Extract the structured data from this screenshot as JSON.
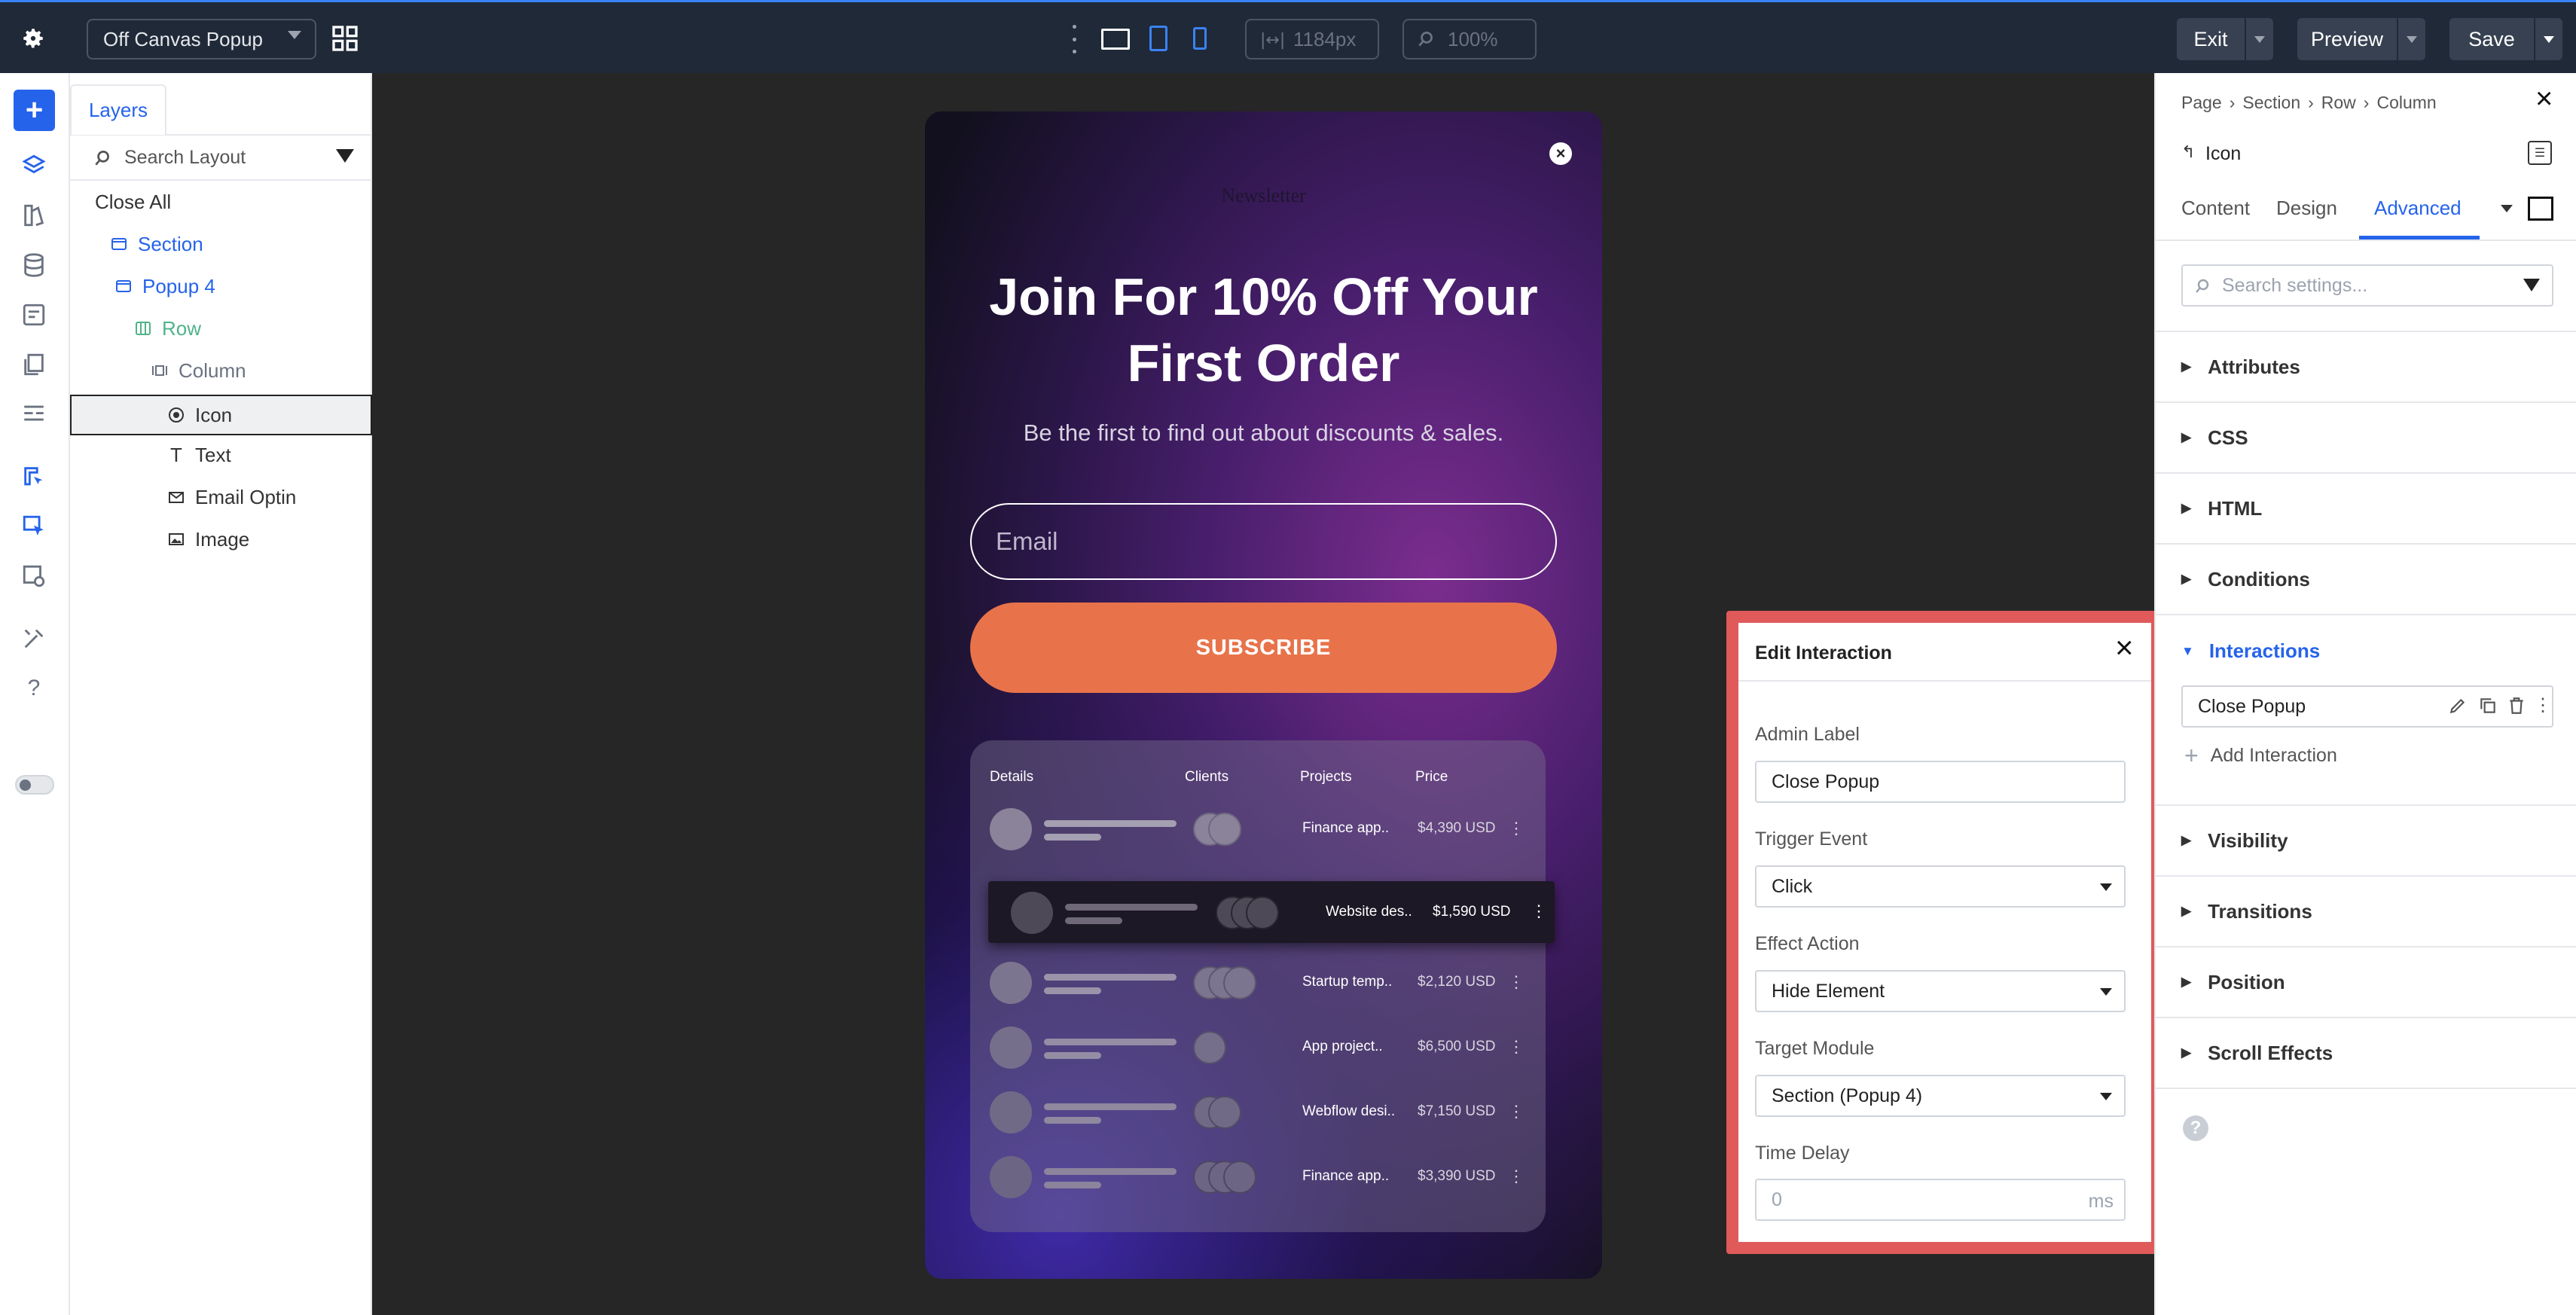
{
  "topbar": {
    "page_select": "Off Canvas Popup",
    "width_value": "1184px",
    "zoom_value": "100%",
    "exit_label": "Exit",
    "preview_label": "Preview",
    "save_label": "Save"
  },
  "layers": {
    "tab": "Layers",
    "search_placeholder": "Search Layout",
    "close_all": "Close All",
    "items": [
      {
        "label": "Section"
      },
      {
        "label": "Popup 4"
      },
      {
        "label": "Row"
      },
      {
        "label": "Column"
      },
      {
        "label": "Icon"
      },
      {
        "label": "Text"
      },
      {
        "label": "Email Optin"
      },
      {
        "label": "Image"
      }
    ]
  },
  "popup": {
    "logo": "Newsletter",
    "headline_1": "Join For 10% Off Your",
    "headline_2": "First Order",
    "subtitle": "Be the first to find out about discounts & sales.",
    "email_placeholder": "Email",
    "subscribe_label": "SUBSCRIBE",
    "table": {
      "headers": [
        "Details",
        "Clients",
        "Projects",
        "Price"
      ],
      "rows": [
        {
          "project": "Finance app..",
          "price": "$4,390 USD"
        },
        {
          "project": "Website des..",
          "price": "$1,590 USD"
        },
        {
          "project": "Startup temp..",
          "price": "$2,120 USD"
        },
        {
          "project": "App project..",
          "price": "$6,500 USD"
        },
        {
          "project": "Webflow desi..",
          "price": "$7,150 USD"
        },
        {
          "project": "Finance app..",
          "price": "$3,390 USD"
        }
      ]
    }
  },
  "edit_interaction": {
    "title": "Edit Interaction",
    "admin_label": "Admin Label",
    "admin_value": "Close Popup",
    "trigger_label": "Trigger Event",
    "trigger_value": "Click",
    "effect_label": "Effect Action",
    "effect_value": "Hide Element",
    "target_label": "Target Module",
    "target_value": "Section (Popup 4)",
    "delay_label": "Time Delay",
    "delay_placeholder": "0",
    "delay_unit": "ms"
  },
  "right_panel": {
    "breadcrumb": [
      "Page",
      "Section",
      "Row",
      "Column"
    ],
    "module_title": "Icon",
    "tabs": [
      "Content",
      "Design",
      "Advanced"
    ],
    "search_placeholder": "Search settings...",
    "sections": [
      "Attributes",
      "CSS",
      "HTML",
      "Conditions",
      "Interactions",
      "Visibility",
      "Transitions",
      "Position",
      "Scroll Effects"
    ],
    "interaction_item": "Close Popup",
    "add_interaction": "Add Interaction"
  },
  "colors": {
    "accent": "#2563eb",
    "green": "#4fb38a",
    "orange": "#e8734a",
    "highlight_border": "#e05a5a"
  }
}
